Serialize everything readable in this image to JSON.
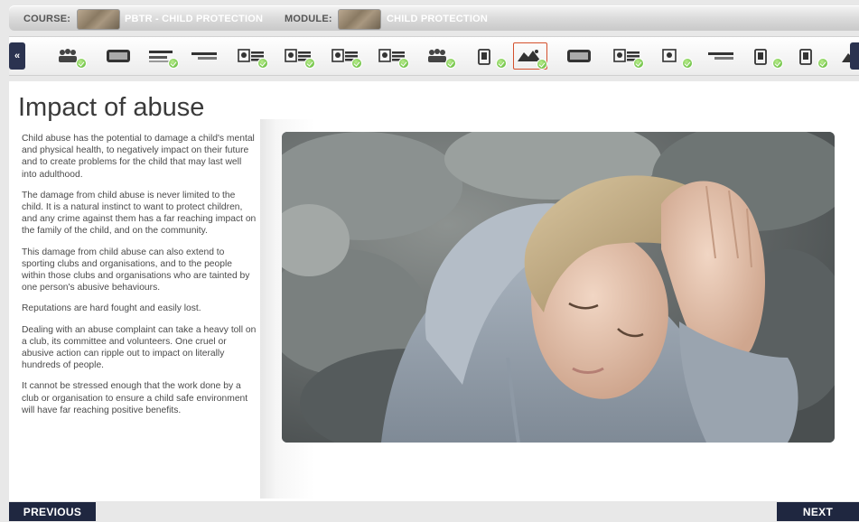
{
  "header": {
    "course_label": "COURSE:",
    "course_name": "PBTR - CHILD PROTECTION",
    "module_label": "MODULE:",
    "module_name": "CHILD PROTECTION"
  },
  "nav": {
    "back_label": "«",
    "slides": [
      {
        "icon": "group-icon",
        "completed": true
      },
      {
        "icon": "video-icon",
        "completed": false
      },
      {
        "icon": "progress-text-icon",
        "completed": true
      },
      {
        "icon": "text-lines-icon",
        "completed": false
      },
      {
        "icon": "image-text-icon",
        "completed": true
      },
      {
        "icon": "image-text-icon",
        "completed": true
      },
      {
        "icon": "image-text-icon",
        "completed": true
      },
      {
        "icon": "image-text-icon",
        "completed": true
      },
      {
        "icon": "group-icon",
        "completed": true
      },
      {
        "icon": "document-icon",
        "completed": true
      },
      {
        "icon": "landscape-icon",
        "completed": true,
        "current": true
      },
      {
        "icon": "video-icon",
        "completed": false
      },
      {
        "icon": "image-text-icon",
        "completed": true
      },
      {
        "icon": "image-icon",
        "completed": true
      },
      {
        "icon": "text-lines-icon",
        "completed": false
      },
      {
        "icon": "document-icon",
        "completed": true
      },
      {
        "icon": "document-icon",
        "completed": true
      },
      {
        "icon": "landscape-icon",
        "completed": false
      }
    ]
  },
  "content": {
    "title": "Impact of abuse",
    "paragraphs": [
      "Child abuse has the potential to damage a child's mental and physical health, to negatively impact on their future and to create problems for the child that may last well into adulthood.",
      "The damage from child abuse is never limited to the child. It is a natural instinct to want to protect children, and any crime against them has a far reaching impact on the family of the child, and on the community.",
      "This damage from child abuse can also extend to sporting clubs and organisations, and to the people within those clubs and organisations who are tainted by one person's abusive behaviours.",
      "Reputations are hard fought and easily lost.",
      "Dealing with an abuse complaint can take a heavy toll on a club, its committee and volunteers. One cruel or abusive action can ripple out to impact on literally hundreds of people.",
      "It cannot be stressed enough that the work done by a club or organisation to ensure a child safe environment will have far reaching positive benefits."
    ]
  },
  "footer": {
    "previous_label": "PREVIOUS",
    "next_label": "NEXT"
  },
  "colors": {
    "nav_dark": "#1f2740",
    "current_slide_border": "#d4502c",
    "check_green": "#54b32c"
  }
}
